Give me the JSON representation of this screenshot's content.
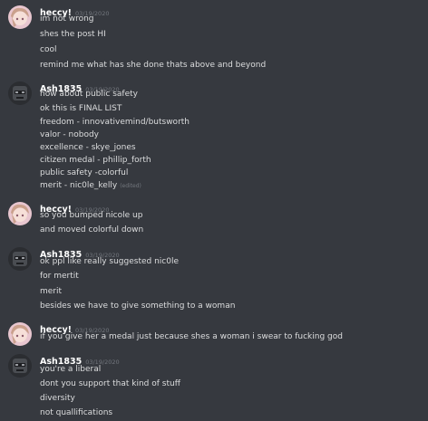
{
  "colors": {
    "background": "#36393f",
    "username": "#ffffff",
    "message_text": "#dcddde",
    "timestamp": "#72767d"
  },
  "groups": [
    {
      "author": "heccy!",
      "avatar_icon": "anime-girl-avatar-icon",
      "timestamp": "03/19/2020",
      "messages": [
        "im not wrong",
        "shes the post HI",
        "cool",
        "remind me what has she done thats above and beyond"
      ]
    },
    {
      "author": "Ash1835",
      "avatar_icon": "masked-figure-avatar-icon",
      "timestamp": "03/19/2020",
      "messages": [
        "how about public safety",
        "ok this is FINAL LIST",
        "freedom - innovativemind/butsworth",
        "valor - nobody",
        "excellence - skye_jones",
        "citizen medal - phillip_forth",
        "public safety -colorful",
        "merit - nic0le_kelly"
      ],
      "edited_label": "(edited)"
    },
    {
      "author": "heccy!",
      "avatar_icon": "anime-girl-avatar-icon",
      "timestamp": "03/19/2020",
      "messages": [
        "so you bumped nicole up",
        "and moved colorful down"
      ]
    },
    {
      "author": "Ash1835",
      "avatar_icon": "masked-figure-avatar-icon",
      "timestamp": "03/19/2020",
      "messages": [
        "ok ppl like really suggested nic0le",
        "for mertit",
        "merit",
        "besides we have to give something to a woman"
      ]
    },
    {
      "author": "heccy!",
      "avatar_icon": "anime-girl-avatar-icon",
      "timestamp": "03/19/2020",
      "messages": [
        "if you give her a medal just because shes a woman i swear to fucking god"
      ]
    },
    {
      "author": "Ash1835",
      "avatar_icon": "masked-figure-avatar-icon",
      "timestamp": "03/19/2020",
      "messages": [
        "you're a liberal",
        "dont you support that kind of stuff",
        "diversity",
        "not quallifications"
      ]
    }
  ]
}
